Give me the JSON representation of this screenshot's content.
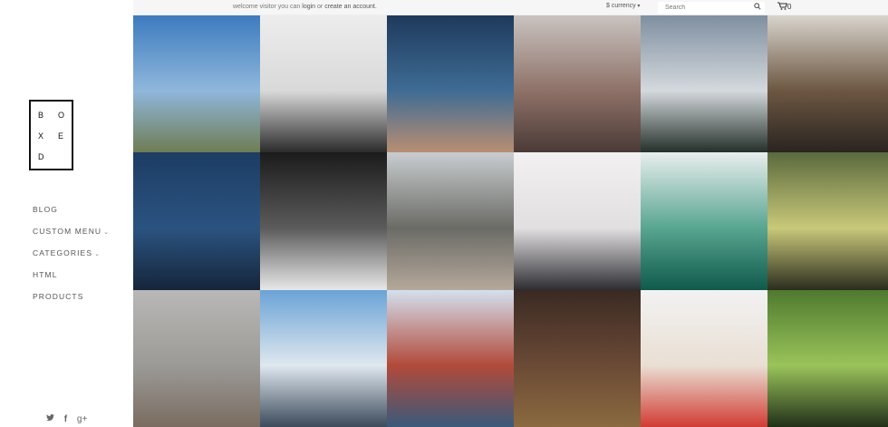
{
  "logo": {
    "letters": [
      "B",
      "O",
      "X",
      "E",
      "D"
    ]
  },
  "nav": {
    "blog": "BLOG",
    "custom_menu": "CUSTOM MENU",
    "categories": "CATEGORIES",
    "html": "HTML",
    "products": "PRODUCTS"
  },
  "topbar": {
    "welcome_prefix": "welcome visitor you can",
    "login": "login",
    "or": "or",
    "create_account": "create an account.",
    "currency": "$ currency",
    "search_placeholder": "Search",
    "cart_count": "0"
  },
  "social": {
    "twitter": "twitter-icon",
    "facebook": "facebook-icon",
    "googleplus": "google-plus-icon"
  },
  "gallery": {
    "tiles": [
      {
        "name": "photo-hillside-sky",
        "colors": [
          "#3d7bbf",
          "#8fb7dc",
          "#6f7d52"
        ]
      },
      {
        "name": "photo-typewriter",
        "colors": [
          "#ededed",
          "#d9d9d9",
          "#2b2b2b"
        ]
      },
      {
        "name": "photo-lake-dock",
        "colors": [
          "#1e3a5c",
          "#3f6c94",
          "#b88e72"
        ]
      },
      {
        "name": "photo-city-skyline",
        "colors": [
          "#c9c3c0",
          "#8e7268",
          "#4b3a36"
        ]
      },
      {
        "name": "photo-misty-forest",
        "colors": [
          "#7f8fa0",
          "#d4d9dd",
          "#25302a"
        ]
      },
      {
        "name": "photo-library-shelves",
        "colors": [
          "#d8d4cc",
          "#6c5742",
          "#2a2420"
        ]
      },
      {
        "name": "photo-underwater-stars",
        "colors": [
          "#1c3d64",
          "#2b5380",
          "#15253a"
        ]
      },
      {
        "name": "photo-concert-band",
        "colors": [
          "#1b1b1b",
          "#5b5b5b",
          "#e8e8e8"
        ]
      },
      {
        "name": "photo-coast-waves",
        "colors": [
          "#c9cdd0",
          "#6b6b66",
          "#b5a89a"
        ]
      },
      {
        "name": "photo-foggy-peak",
        "colors": [
          "#f2f0f0",
          "#e1dfe0",
          "#2d2d32"
        ]
      },
      {
        "name": "photo-canoe-lake",
        "colors": [
          "#e9eeee",
          "#58a590",
          "#0f5a4c"
        ]
      },
      {
        "name": "photo-sunlit-forest",
        "colors": [
          "#5a6a3d",
          "#c9c87a",
          "#2b2d1e"
        ]
      },
      {
        "name": "photo-beach-walkers",
        "colors": [
          "#b9b8b6",
          "#9b9a97",
          "#7a6c60"
        ]
      },
      {
        "name": "photo-city-clouds",
        "colors": [
          "#6aa3d6",
          "#dfe7ef",
          "#3c4a5a"
        ]
      },
      {
        "name": "photo-golden-gate",
        "colors": [
          "#d3e0ee",
          "#b24a3a",
          "#3a5a7a"
        ]
      },
      {
        "name": "photo-herbs-table",
        "colors": [
          "#3a2a22",
          "#6b4a36",
          "#8a6a3e"
        ]
      },
      {
        "name": "photo-strawberry-bowl",
        "colors": [
          "#f2f2f2",
          "#e9dfd4",
          "#d13c33"
        ]
      },
      {
        "name": "photo-green-woods",
        "colors": [
          "#4f7a2e",
          "#9ac35a",
          "#22301a"
        ]
      }
    ]
  }
}
